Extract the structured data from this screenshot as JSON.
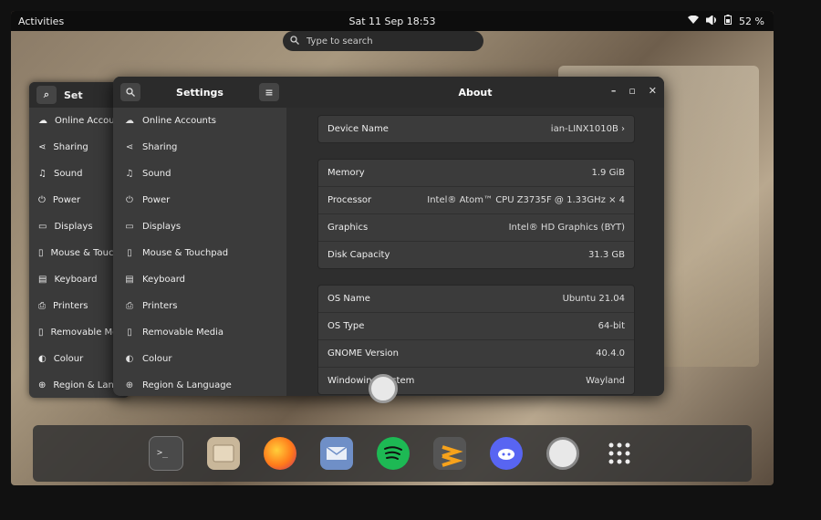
{
  "topbar": {
    "activities": "Activities",
    "clock": "Sat 11 Sep  18:53",
    "battery": "52 %"
  },
  "search": {
    "placeholder": "Type to search"
  },
  "background_window": {
    "title": "Set",
    "items": [
      "Online Accoun",
      "Sharing",
      "Sound",
      "Power",
      "Displays",
      "Mouse & Touc",
      "Keyboard",
      "Printers",
      "Removable Me",
      "Colour",
      "Region & Lang"
    ]
  },
  "settings": {
    "sidebar_title": "Settings",
    "sidebar_items": [
      {
        "label": "Online Accounts",
        "icon": "cloud-icon"
      },
      {
        "label": "Sharing",
        "icon": "share-icon"
      },
      {
        "label": "Sound",
        "icon": "music-note-icon"
      },
      {
        "label": "Power",
        "icon": "power-icon"
      },
      {
        "label": "Displays",
        "icon": "display-icon"
      },
      {
        "label": "Mouse & Touchpad",
        "icon": "mouse-icon"
      },
      {
        "label": "Keyboard",
        "icon": "keyboard-icon"
      },
      {
        "label": "Printers",
        "icon": "printer-icon"
      },
      {
        "label": "Removable Media",
        "icon": "media-icon"
      },
      {
        "label": "Colour",
        "icon": "colour-icon"
      },
      {
        "label": "Region & Language",
        "icon": "globe-icon"
      }
    ],
    "page_title": "About",
    "device": {
      "label": "Device Name",
      "value": "ian-LINX1010B"
    },
    "hardware": [
      {
        "label": "Memory",
        "value": "1.9 GiB"
      },
      {
        "label": "Processor",
        "value": "Intel® Atom™ CPU Z3735F @ 1.33GHz × 4"
      },
      {
        "label": "Graphics",
        "value": "Intel® HD Graphics (BYT)"
      },
      {
        "label": "Disk Capacity",
        "value": "31.3 GB"
      }
    ],
    "software": [
      {
        "label": "OS Name",
        "value": "Ubuntu 21.04"
      },
      {
        "label": "OS Type",
        "value": "64-bit"
      },
      {
        "label": "GNOME Version",
        "value": "40.4.0"
      },
      {
        "label": "Windowing System",
        "value": "Wayland"
      }
    ]
  },
  "dock": [
    "terminal-icon",
    "files-icon",
    "firefox-icon",
    "mail-icon",
    "spotify-icon",
    "sublime-text-icon",
    "discord-icon",
    "settings-icon",
    "app-grid-icon"
  ]
}
